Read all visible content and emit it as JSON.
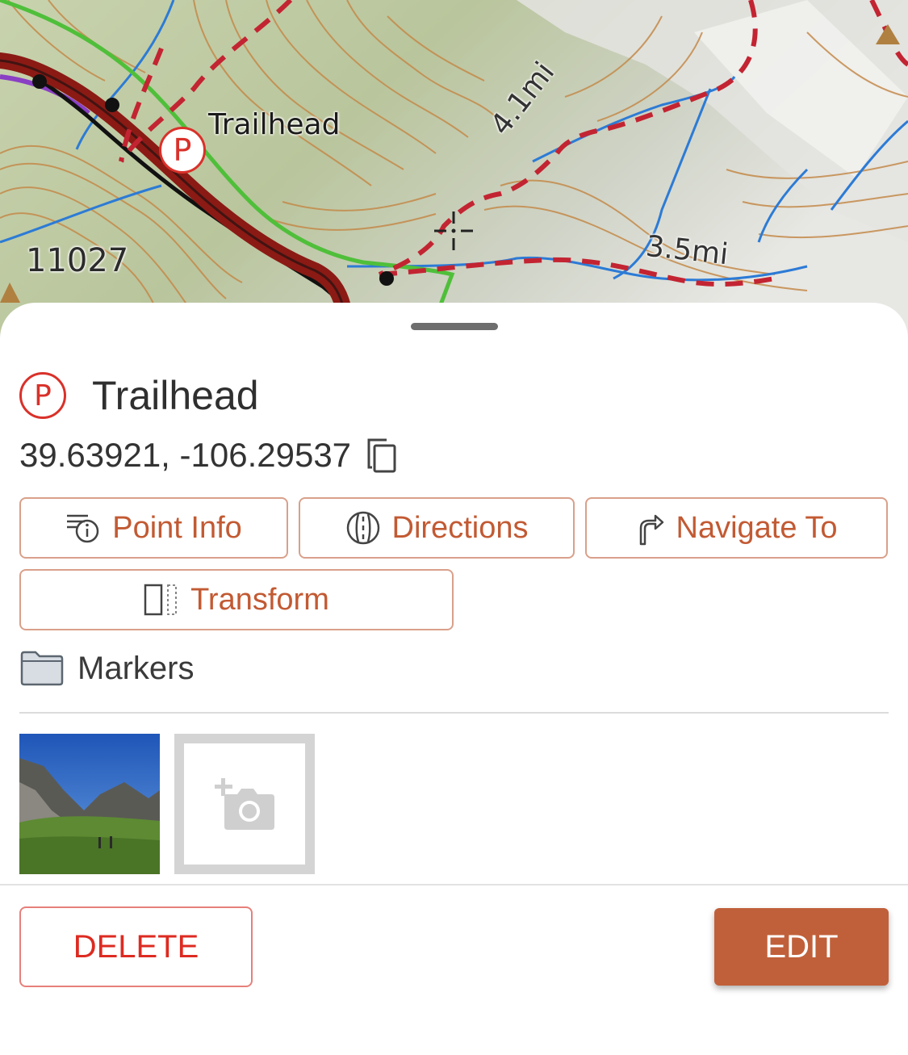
{
  "map": {
    "pin_label": "Trailhead",
    "pin_letter": "P",
    "elevation_label": "11027",
    "distance_label_1": "4.1mi",
    "distance_label_2": "3.5mi",
    "colors": {
      "route": "#8b1a14",
      "trail_dashed": "#c32432",
      "green_trail": "#4fbf3a",
      "stream": "#2c7bd6",
      "contour": "#c48a4a"
    }
  },
  "sheet": {
    "pin_letter": "P",
    "title": "Trailhead",
    "coordinates": "39.63921, -106.29537",
    "buttons": {
      "point_info": "Point Info",
      "directions": "Directions",
      "navigate_to": "Navigate To",
      "transform": "Transform"
    },
    "folder": "Markers",
    "delete_label": "DELETE",
    "edit_label": "EDIT"
  },
  "colors": {
    "accent": "#c25a33",
    "edit_bg": "#c0603a",
    "delete": "#dd2b21",
    "pin_red": "#d9312a"
  }
}
